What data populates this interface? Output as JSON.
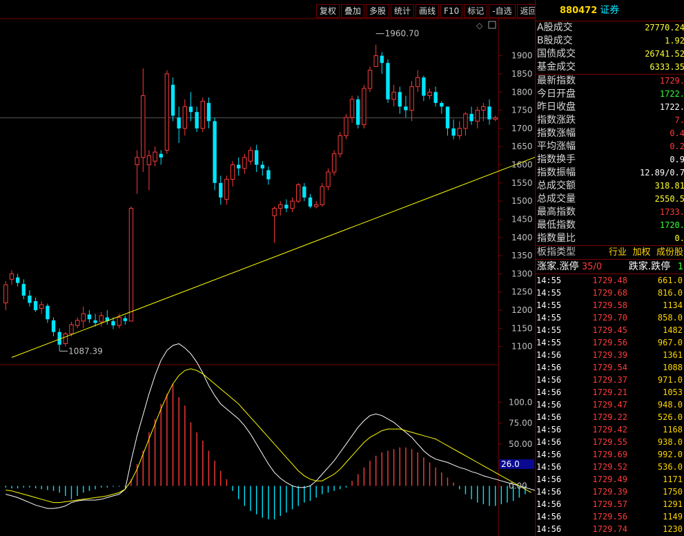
{
  "toolbar": {
    "items": [
      "复权",
      "叠加",
      "多股",
      "统计",
      "画线",
      "F10",
      "标记",
      "-自选",
      "返回"
    ]
  },
  "colors": {
    "up": "#ff3b3b",
    "down": "#00e5ff",
    "trendline": "#ffff00",
    "ma_white": "#ffffff",
    "ma_yellow": "#ffff00",
    "grid": "#7a0000"
  },
  "chart_data": [
    {
      "type": "candlestick",
      "ylim": [
        1050,
        2000
      ],
      "yticks": [
        1100,
        1150,
        1200,
        1250,
        1300,
        1350,
        1400,
        1450,
        1500,
        1550,
        1600,
        1650,
        1700,
        1750,
        1800,
        1850,
        1900
      ],
      "annotations": [
        {
          "label": "1960.70",
          "value": 1960.7
        },
        {
          "label": "1087.39",
          "value": 1087.39
        }
      ],
      "last_price": 1729,
      "trendline": {
        "from": [
          1,
          1070
        ],
        "to": [
          110,
          1755
        ]
      },
      "candles": [
        [
          1220,
          1270,
          1200,
          1280
        ],
        [
          1285,
          1300,
          1270,
          1310
        ],
        [
          1290,
          1275,
          1265,
          1300
        ],
        [
          1272,
          1240,
          1230,
          1285
        ],
        [
          1240,
          1220,
          1210,
          1255
        ],
        [
          1225,
          1200,
          1195,
          1235
        ],
        [
          1205,
          1215,
          1190,
          1225
        ],
        [
          1212,
          1175,
          1165,
          1218
        ],
        [
          1172,
          1140,
          1128,
          1180
        ],
        [
          1140,
          1105,
          1088,
          1150
        ],
        [
          1108,
          1135,
          1100,
          1140
        ],
        [
          1135,
          1160,
          1128,
          1168
        ],
        [
          1158,
          1172,
          1150,
          1180
        ],
        [
          1170,
          1190,
          1150,
          1210
        ],
        [
          1188,
          1175,
          1165,
          1200
        ],
        [
          1172,
          1165,
          1155,
          1190
        ],
        [
          1168,
          1185,
          1155,
          1195
        ],
        [
          1180,
          1170,
          1160,
          1200
        ],
        [
          1170,
          1158,
          1148,
          1180
        ],
        [
          1158,
          1180,
          1150,
          1190
        ],
        [
          1178,
          1170,
          1160,
          1185
        ],
        [
          1170,
          1480,
          1170,
          1485
        ],
        [
          1600,
          1620,
          1520,
          1640
        ],
        [
          1620,
          1790,
          1580,
          1865
        ],
        [
          1600,
          1625,
          1530,
          1640
        ],
        [
          1610,
          1635,
          1595,
          1650
        ],
        [
          1630,
          1620,
          1600,
          1640
        ],
        [
          1640,
          1850,
          1630,
          1860
        ],
        [
          1820,
          1735,
          1720,
          1840
        ],
        [
          1730,
          1700,
          1660,
          1760
        ],
        [
          1700,
          1760,
          1680,
          1780
        ],
        [
          1760,
          1745,
          1720,
          1800
        ],
        [
          1745,
          1700,
          1690,
          1760
        ],
        [
          1700,
          1775,
          1690,
          1785
        ],
        [
          1770,
          1720,
          1700,
          1785
        ],
        [
          1720,
          1550,
          1530,
          1730
        ],
        [
          1550,
          1510,
          1490,
          1570
        ],
        [
          1505,
          1560,
          1490,
          1570
        ],
        [
          1560,
          1600,
          1540,
          1610
        ],
        [
          1600,
          1590,
          1570,
          1620
        ],
        [
          1590,
          1620,
          1575,
          1630
        ],
        [
          1610,
          1640,
          1600,
          1650
        ],
        [
          1640,
          1600,
          1580,
          1655
        ],
        [
          1600,
          1590,
          1570,
          1610
        ],
        [
          1585,
          1560,
          1545,
          1595
        ],
        [
          1460,
          1480,
          1385,
          1485
        ],
        [
          1480,
          1490,
          1460,
          1500
        ],
        [
          1490,
          1480,
          1470,
          1505
        ],
        [
          1480,
          1500,
          1470,
          1510
        ],
        [
          1500,
          1545,
          1495,
          1550
        ],
        [
          1540,
          1510,
          1500,
          1550
        ],
        [
          1510,
          1485,
          1480,
          1520
        ],
        [
          1485,
          1490,
          1480,
          1500
        ],
        [
          1490,
          1540,
          1485,
          1550
        ],
        [
          1540,
          1580,
          1530,
          1590
        ],
        [
          1580,
          1630,
          1570,
          1640
        ],
        [
          1630,
          1680,
          1620,
          1690
        ],
        [
          1680,
          1730,
          1670,
          1740
        ],
        [
          1730,
          1780,
          1715,
          1790
        ],
        [
          1780,
          1710,
          1700,
          1790
        ],
        [
          1710,
          1810,
          1700,
          1820
        ],
        [
          1810,
          1860,
          1800,
          1870
        ],
        [
          1870,
          1900,
          1870,
          1930
        ],
        [
          1900,
          1880,
          1850,
          1910
        ],
        [
          1880,
          1780,
          1770,
          1890
        ],
        [
          1780,
          1800,
          1760,
          1820
        ],
        [
          1800,
          1760,
          1740,
          1815
        ],
        [
          1760,
          1750,
          1730,
          1790
        ],
        [
          1750,
          1815,
          1720,
          1830
        ],
        [
          1815,
          1840,
          1800,
          1860
        ],
        [
          1840,
          1790,
          1775,
          1845
        ],
        [
          1790,
          1800,
          1780,
          1810
        ],
        [
          1800,
          1770,
          1760,
          1815
        ],
        [
          1770,
          1760,
          1740,
          1775
        ],
        [
          1760,
          1700,
          1680,
          1760
        ],
        [
          1700,
          1680,
          1670,
          1725
        ],
        [
          1680,
          1700,
          1670,
          1720
        ],
        [
          1700,
          1740,
          1680,
          1745
        ],
        [
          1740,
          1720,
          1710,
          1760
        ],
        [
          1720,
          1750,
          1700,
          1760
        ],
        [
          1750,
          1760,
          1720,
          1770
        ],
        [
          1760,
          1725,
          1710,
          1780
        ],
        [
          1725,
          1729,
          1720,
          1735
        ]
      ]
    },
    {
      "type": "macd",
      "ylim": [
        -55,
        135
      ],
      "yticks": [
        0,
        25,
        50,
        75,
        100
      ],
      "ytick_labels": [
        "0.00",
        "25.00",
        "50.00",
        "75.00",
        "100.0"
      ],
      "current_marker": "26.0",
      "histogram": [
        -2,
        -3,
        -3,
        -2,
        -2,
        -3,
        -4,
        -5,
        -6,
        -8,
        -12,
        -16,
        -12,
        -8,
        -6,
        -4,
        -2,
        -2,
        -1,
        -1,
        -1,
        8,
        26,
        42,
        64,
        80,
        98,
        110,
        122,
        106,
        96,
        76,
        64,
        54,
        42,
        30,
        18,
        8,
        -6,
        -16,
        -24,
        -30,
        -34,
        -38,
        -40,
        -40,
        -36,
        -32,
        -28,
        -24,
        -20,
        -18,
        -14,
        -10,
        -8,
        -6,
        -4,
        -2,
        6,
        14,
        22,
        30,
        36,
        40,
        42,
        44,
        46,
        46,
        44,
        40,
        34,
        28,
        22,
        16,
        10,
        4,
        -4,
        -10,
        -16,
        -20,
        -22,
        -24,
        -24,
        -22,
        -20,
        -18,
        -14,
        -10
      ],
      "series": [
        {
          "name": "DIF",
          "color": "#ffffff",
          "values": [
            -10,
            -12,
            -14,
            -17,
            -20,
            -23,
            -25,
            -27,
            -27,
            -26,
            -24,
            -20,
            -18,
            -17,
            -17,
            -17,
            -16,
            -14,
            -12,
            -10,
            -4,
            30,
            60,
            85,
            110,
            132,
            150,
            162,
            168,
            170,
            165,
            158,
            148,
            135,
            120,
            108,
            98,
            92,
            86,
            80,
            72,
            62,
            50,
            38,
            26,
            16,
            9,
            4,
            0,
            -2,
            -2,
            0,
            6,
            14,
            22,
            30,
            40,
            50,
            60,
            70,
            78,
            84,
            86,
            84,
            80,
            76,
            70,
            64,
            58,
            50,
            42,
            36,
            32,
            30,
            28,
            25,
            22,
            20,
            17,
            15,
            12,
            10,
            8,
            6,
            4,
            2,
            0,
            -2,
            -4,
            -6
          ]
        },
        {
          "name": "DEA",
          "color": "#ffff00",
          "values": [
            -5,
            -6,
            -8,
            -10,
            -12,
            -14,
            -16,
            -18,
            -20,
            -20,
            -19,
            -18,
            -17,
            -16,
            -15,
            -14,
            -13,
            -12,
            -10,
            -8,
            -4,
            6,
            20,
            38,
            56,
            74,
            92,
            108,
            122,
            132,
            138,
            140,
            138,
            134,
            128,
            122,
            116,
            110,
            104,
            98,
            90,
            82,
            74,
            66,
            58,
            50,
            42,
            34,
            26,
            18,
            12,
            8,
            6,
            6,
            10,
            14,
            20,
            28,
            36,
            44,
            52,
            58,
            62,
            66,
            68,
            68,
            68,
            66,
            64,
            62,
            60,
            58,
            56,
            52,
            48,
            44,
            40,
            36,
            32,
            28,
            24,
            20,
            16,
            12,
            8,
            4,
            0,
            -4,
            -8
          ]
        }
      ]
    }
  ],
  "panel": {
    "code": "880472",
    "name": "证券",
    "stats": [
      {
        "label": "A股成交",
        "value": "27770.24",
        "color": "yellow"
      },
      {
        "label": "B股成交",
        "value": "1.92",
        "color": "yellow"
      },
      {
        "label": "国债成交",
        "value": "26741.52",
        "color": "yellow"
      },
      {
        "label": "基金成交",
        "value": "6333.35",
        "color": "yellow"
      },
      {
        "label": "最新指数",
        "value": "1729.",
        "color": "red"
      },
      {
        "label": "今日开盘",
        "value": "1722.",
        "color": "green"
      },
      {
        "label": "昨日收盘",
        "value": "1722.",
        "color": "white"
      },
      {
        "label": "指数涨跌",
        "value": "7.",
        "color": "red"
      },
      {
        "label": "指数涨幅",
        "value": "0.4",
        "color": "red"
      },
      {
        "label": "平均涨幅",
        "value": "0.2",
        "color": "red"
      },
      {
        "label": "指数换手",
        "value": "0.9",
        "color": "white"
      },
      {
        "label": "指数振幅",
        "value": "12.89/0.7",
        "color": "white"
      },
      {
        "label": "总成交额",
        "value": "318.81",
        "color": "yellow"
      },
      {
        "label": "总成交量",
        "value": "2550.5",
        "color": "yellow"
      },
      {
        "label": "最高指数",
        "value": "1733.",
        "color": "red"
      },
      {
        "label": "最低指数",
        "value": "1720.",
        "color": "green"
      },
      {
        "label": "指数量比",
        "value": "0.",
        "color": "yellow"
      }
    ],
    "type_label": "板指类型",
    "type_options": [
      "行业",
      "加权",
      "成份股"
    ],
    "updown_left": "涨家.涨停",
    "updown_left_val": "35/0",
    "updown_right": "跌家.跌停",
    "updown_right_val": "1",
    "ticks": [
      {
        "time": "14:55",
        "price": "1729.48",
        "vol": "661.0"
      },
      {
        "time": "14:55",
        "price": "1729.68",
        "vol": "816.0"
      },
      {
        "time": "14:55",
        "price": "1729.58",
        "vol": "1134"
      },
      {
        "time": "14:55",
        "price": "1729.70",
        "vol": "858.0"
      },
      {
        "time": "14:55",
        "price": "1729.45",
        "vol": "1482"
      },
      {
        "time": "14:55",
        "price": "1729.56",
        "vol": "967.0"
      },
      {
        "time": "14:56",
        "price": "1729.39",
        "vol": "1361"
      },
      {
        "time": "14:56",
        "price": "1729.54",
        "vol": "1088"
      },
      {
        "time": "14:56",
        "price": "1729.37",
        "vol": "971.0"
      },
      {
        "time": "14:56",
        "price": "1729.21",
        "vol": "1053"
      },
      {
        "time": "14:56",
        "price": "1729.47",
        "vol": "948.0"
      },
      {
        "time": "14:56",
        "price": "1729.22",
        "vol": "526.0"
      },
      {
        "time": "14:56",
        "price": "1729.42",
        "vol": "1168"
      },
      {
        "time": "14:56",
        "price": "1729.55",
        "vol": "938.0"
      },
      {
        "time": "14:56",
        "price": "1729.69",
        "vol": "992.0"
      },
      {
        "time": "14:56",
        "price": "1729.52",
        "vol": "536.0"
      },
      {
        "time": "14:56",
        "price": "1729.49",
        "vol": "1171"
      },
      {
        "time": "14:56",
        "price": "1729.39",
        "vol": "1750"
      },
      {
        "time": "14:56",
        "price": "1729.57",
        "vol": "1291"
      },
      {
        "time": "14:56",
        "price": "1729.56",
        "vol": "1149"
      },
      {
        "time": "14:56",
        "price": "1729.74",
        "vol": "1230"
      }
    ]
  }
}
